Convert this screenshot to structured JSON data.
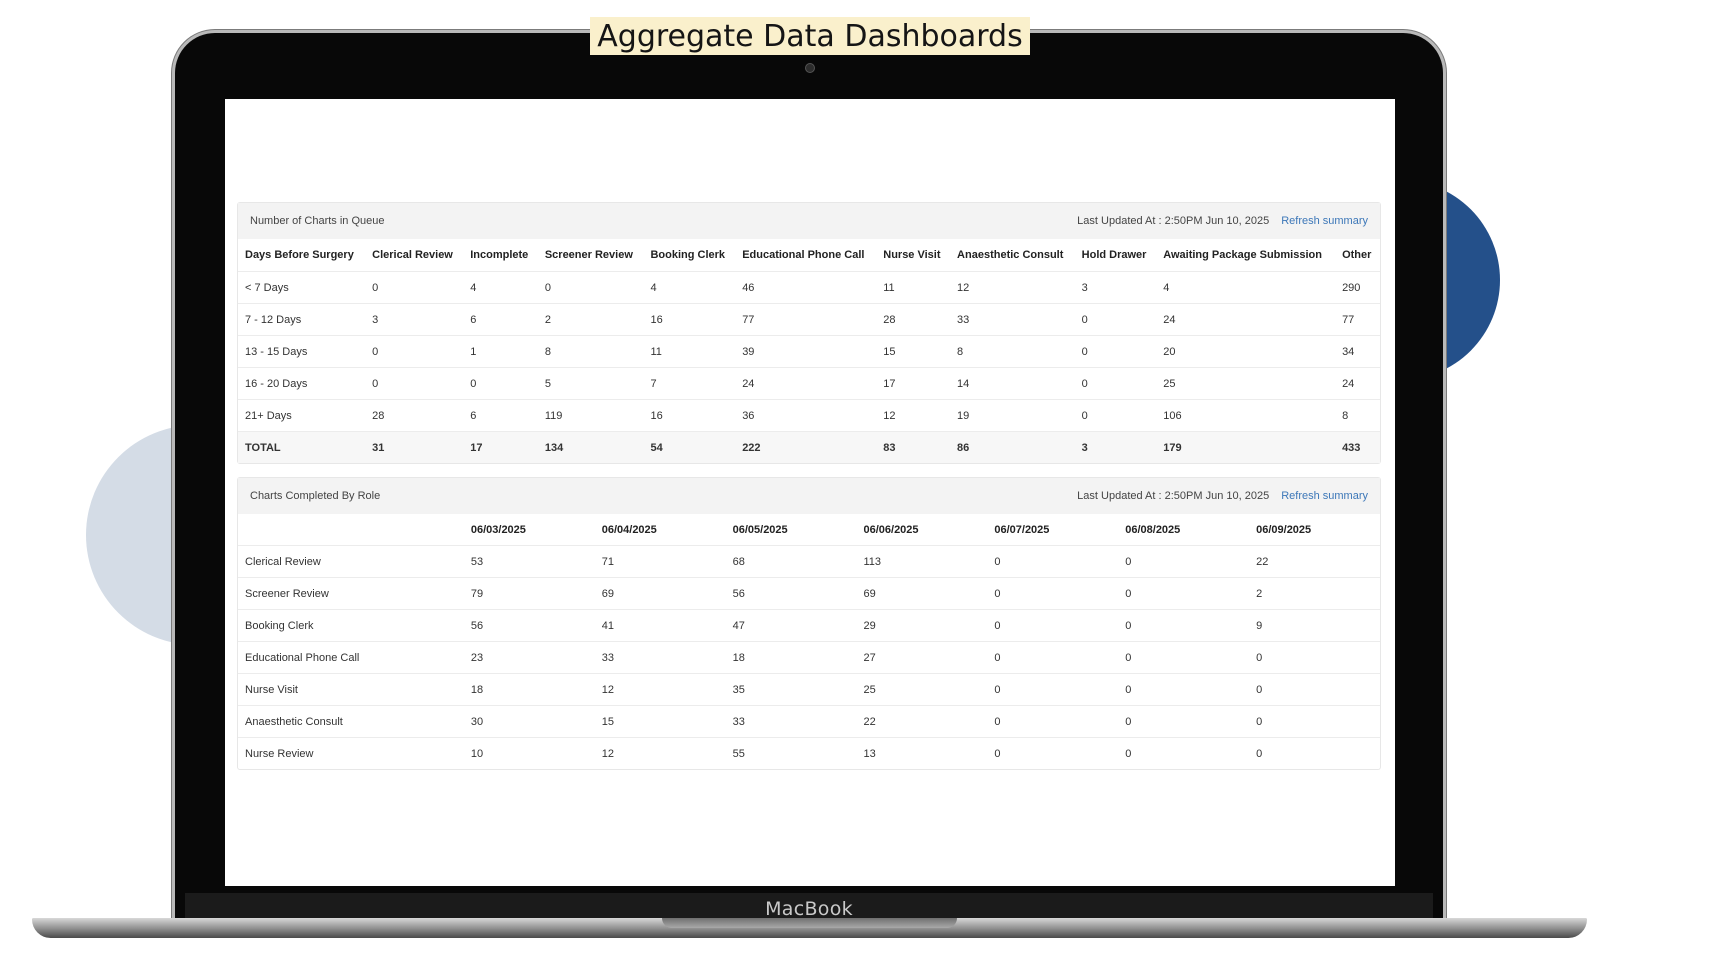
{
  "banner": {
    "title": "Aggregate Data Dashboards"
  },
  "device": {
    "brand": "MacBook"
  },
  "colors": {
    "accent_circle": "#24508a",
    "light_circle": "#d4dce6",
    "link": "#3c77b8"
  },
  "queue_panel": {
    "title": "Number of Charts in Queue",
    "last_updated": "Last Updated At : 2:50PM Jun 10, 2025",
    "refresh_label": "Refresh summary",
    "columns": [
      "Days Before Surgery",
      "Clerical Review",
      "Incomplete",
      "Screener Review",
      "Booking Clerk",
      "Educational Phone Call",
      "Nurse Visit",
      "Anaesthetic Consult",
      "Hold Drawer",
      "Awaiting Package Submission",
      "Other"
    ],
    "rows": [
      [
        "< 7 Days",
        "0",
        "4",
        "0",
        "4",
        "46",
        "11",
        "12",
        "3",
        "4",
        "290"
      ],
      [
        "7 - 12 Days",
        "3",
        "6",
        "2",
        "16",
        "77",
        "28",
        "33",
        "0",
        "24",
        "77"
      ],
      [
        "13 - 15 Days",
        "0",
        "1",
        "8",
        "11",
        "39",
        "15",
        "8",
        "0",
        "20",
        "34"
      ],
      [
        "16 - 20 Days",
        "0",
        "0",
        "5",
        "7",
        "24",
        "17",
        "14",
        "0",
        "25",
        "24"
      ],
      [
        "21+ Days",
        "28",
        "6",
        "119",
        "16",
        "36",
        "12",
        "19",
        "0",
        "106",
        "8"
      ]
    ],
    "total_row": [
      "TOTAL",
      "31",
      "17",
      "134",
      "54",
      "222",
      "83",
      "86",
      "3",
      "179",
      "433"
    ]
  },
  "completed_panel": {
    "title": "Charts Completed By Role",
    "last_updated": "Last Updated At : 2:50PM Jun 10, 2025",
    "refresh_label": "Refresh summary",
    "columns": [
      "",
      "06/03/2025",
      "06/04/2025",
      "06/05/2025",
      "06/06/2025",
      "06/07/2025",
      "06/08/2025",
      "06/09/2025"
    ],
    "rows": [
      [
        "Clerical Review",
        "53",
        "71",
        "68",
        "113",
        "0",
        "0",
        "22"
      ],
      [
        "Screener Review",
        "79",
        "69",
        "56",
        "69",
        "0",
        "0",
        "2"
      ],
      [
        "Booking Clerk",
        "56",
        "41",
        "47",
        "29",
        "0",
        "0",
        "9"
      ],
      [
        "Educational Phone Call",
        "23",
        "33",
        "18",
        "27",
        "0",
        "0",
        "0"
      ],
      [
        "Nurse Visit",
        "18",
        "12",
        "35",
        "25",
        "0",
        "0",
        "0"
      ],
      [
        "Anaesthetic Consult",
        "30",
        "15",
        "33",
        "22",
        "0",
        "0",
        "0"
      ],
      [
        "Nurse Review",
        "10",
        "12",
        "55",
        "13",
        "0",
        "0",
        "0"
      ]
    ]
  }
}
